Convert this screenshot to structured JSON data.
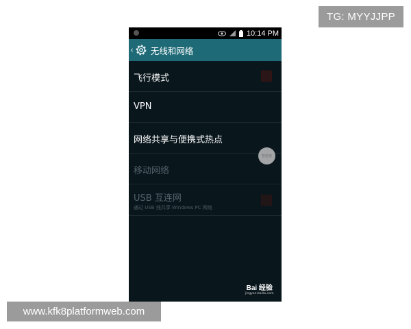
{
  "overlay": {
    "tg_label": "TG: MYYJJPP",
    "site_url": "www.kfk8platformweb.com"
  },
  "statusbar": {
    "time": "10:14 PM",
    "icons": [
      "eye-icon",
      "signal-icon",
      "battery-icon"
    ]
  },
  "actionbar": {
    "back_icon": "chevron-left-icon",
    "settings_icon": "gear-icon",
    "title": "无线和网络"
  },
  "settings": [
    {
      "label": "飞行模式",
      "enabled": true,
      "checkbox": true
    },
    {
      "label": "VPN",
      "enabled": true,
      "checkbox": false
    },
    {
      "label": "网络共享与便携式热点",
      "enabled": true,
      "checkbox": false
    },
    {
      "label": "移动网络",
      "enabled": false,
      "checkbox": false
    },
    {
      "label": "USB 互连网",
      "sublabel": "通过 USB 线共享 Windows PC 网络",
      "enabled": false,
      "checkbox": true
    }
  ],
  "float_button": {
    "label": "智能键"
  },
  "watermark": {
    "logo": "Bai 经验",
    "url": "jingyan.baidu.com"
  },
  "colors": {
    "actionbar": "#1f6a77",
    "background": "#09161c",
    "overlay_box": "#9b9b9b"
  }
}
